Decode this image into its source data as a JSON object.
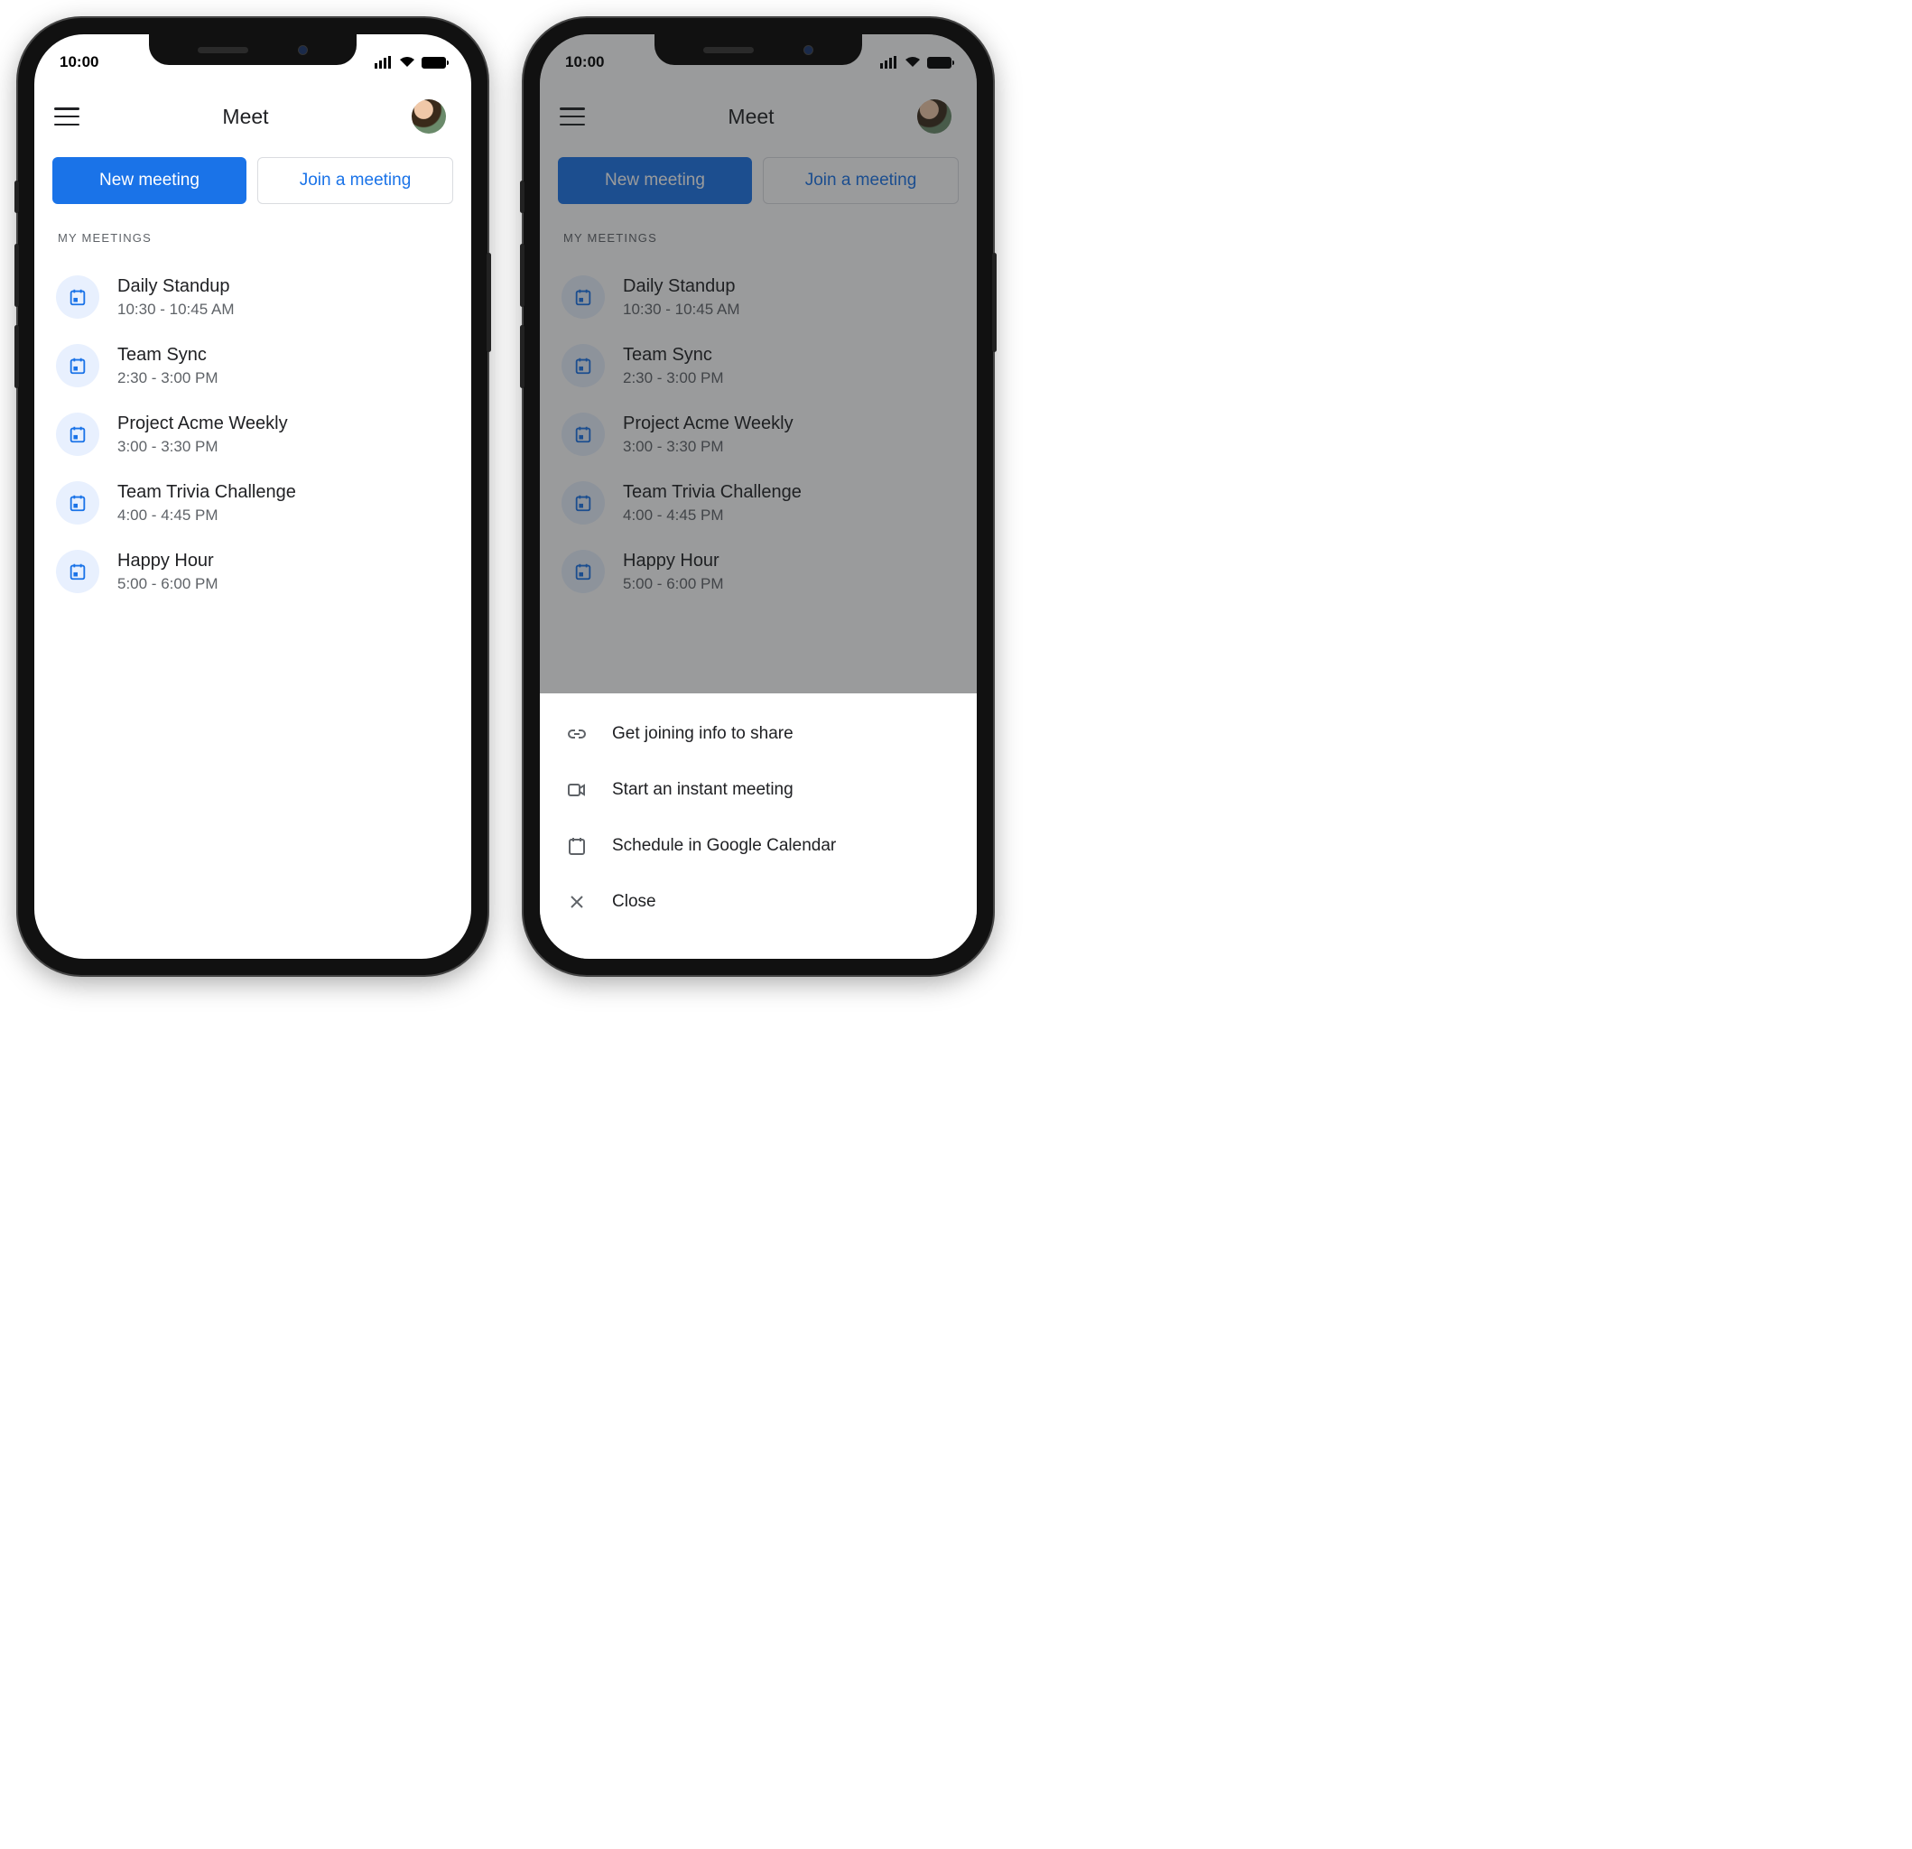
{
  "status": {
    "time": "10:00"
  },
  "header": {
    "title": "Meet"
  },
  "actions": {
    "new_meeting": "New meeting",
    "join_meeting": "Join a meeting"
  },
  "section_label": "MY MEETINGS",
  "meetings": [
    {
      "title": "Daily Standup",
      "time": "10:30 - 10:45 AM"
    },
    {
      "title": "Team Sync",
      "time": "2:30 - 3:00 PM"
    },
    {
      "title": "Project Acme Weekly",
      "time": "3:00 - 3:30 PM"
    },
    {
      "title": "Team Trivia Challenge",
      "time": "4:00 - 4:45 PM"
    },
    {
      "title": "Happy Hour",
      "time": "5:00 - 6:00 PM"
    }
  ],
  "sheet": {
    "share": "Get joining info to share",
    "instant": "Start an instant meeting",
    "schedule": "Schedule in Google Calendar",
    "close": "Close"
  }
}
